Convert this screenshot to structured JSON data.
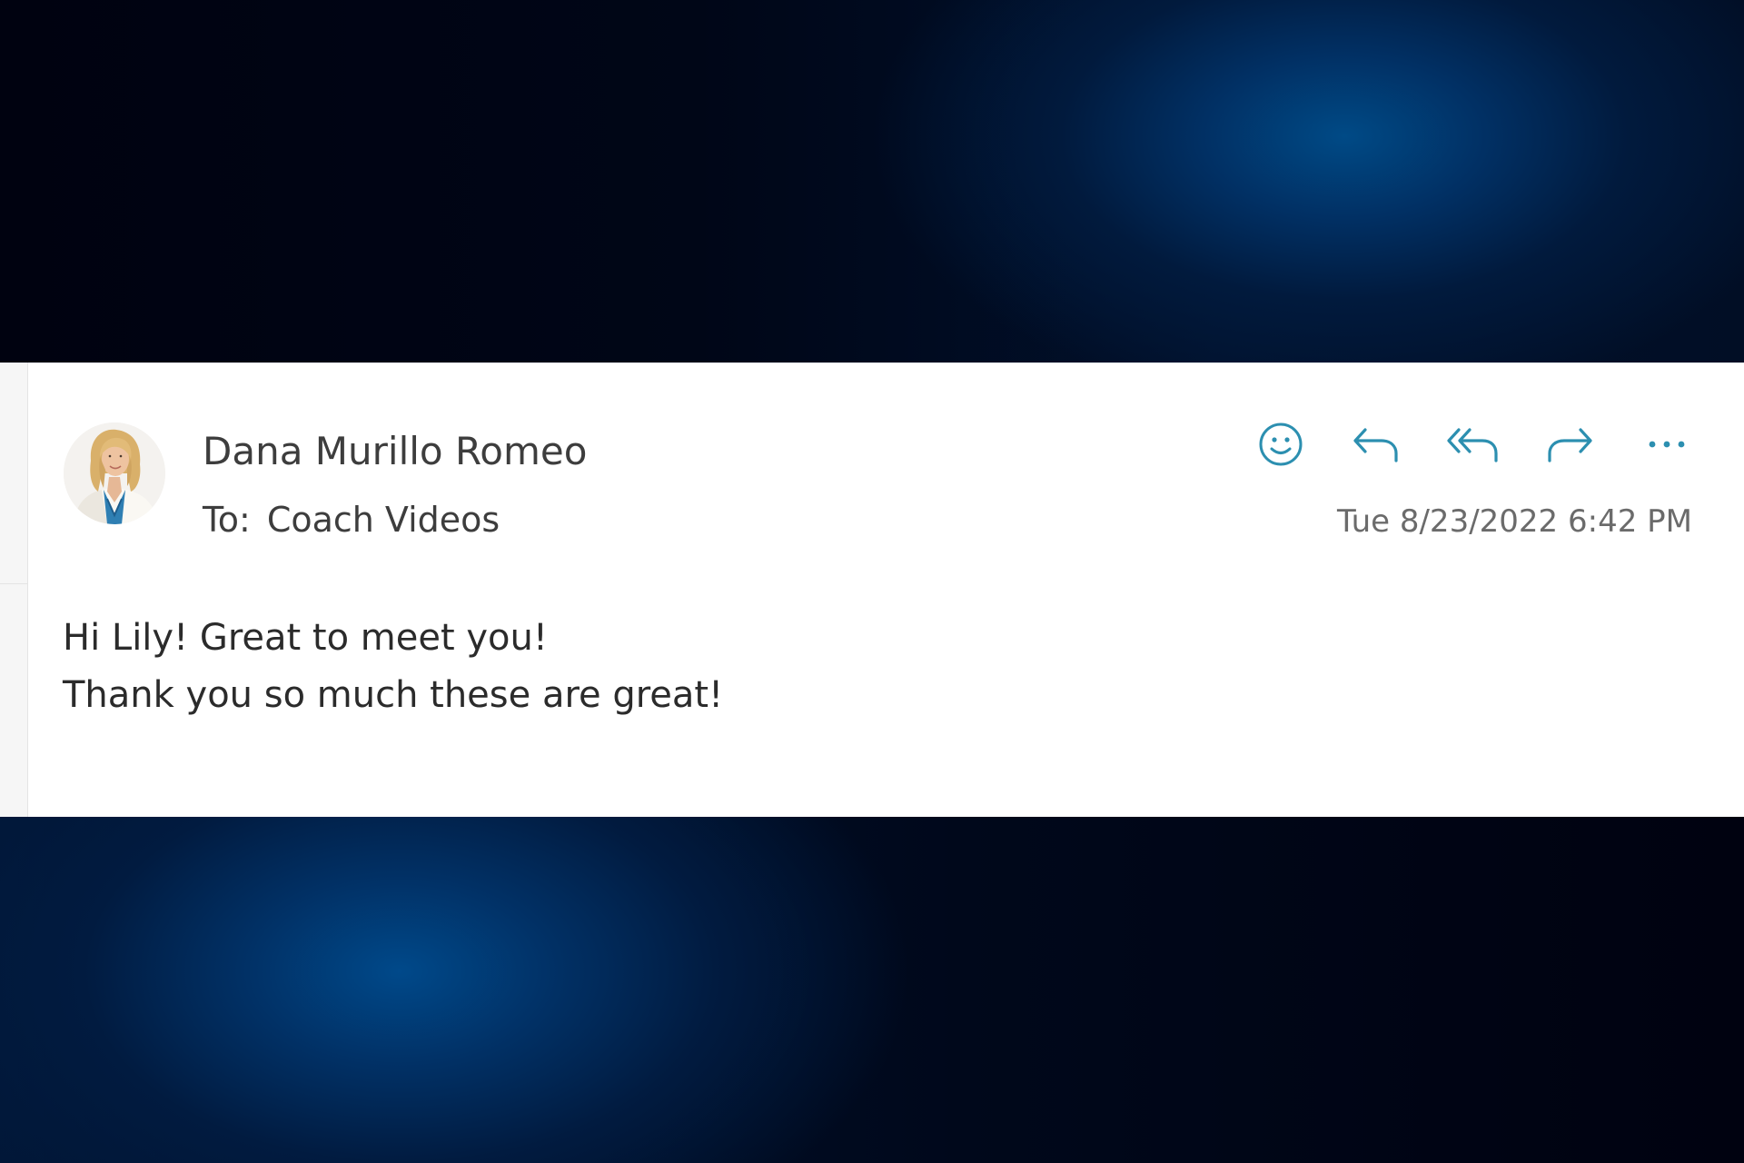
{
  "message": {
    "sender_name": "Dana Murillo Romeo",
    "to_label": "To:",
    "to_recipient": "Coach Videos",
    "timestamp": "Tue 8/23/2022 6:42 PM",
    "body_lines": [
      "Hi Lily! Great to meet you!",
      "Thank you so much these are great!"
    ]
  },
  "actions": [
    {
      "name": "emoji-react-button",
      "icon": "smiley-icon"
    },
    {
      "name": "reply-button",
      "icon": "reply-icon"
    },
    {
      "name": "reply-all-button",
      "icon": "reply-all-icon"
    },
    {
      "name": "forward-button",
      "icon": "forward-icon"
    },
    {
      "name": "more-options-button",
      "icon": "more-horizontal-icon"
    }
  ],
  "colors": {
    "accent": "#2c8fb0",
    "background_blue": "#00498a",
    "background_dark": "#000310",
    "panel": "#ffffff",
    "text_primary": "#3d3d3d",
    "text_secondary": "#6b6b6b"
  }
}
